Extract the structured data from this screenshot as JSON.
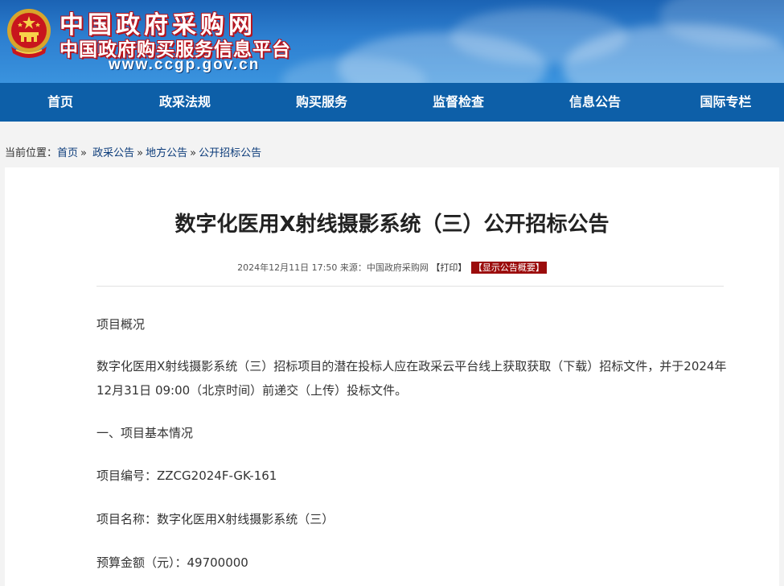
{
  "header": {
    "title_main": "中国政府采购网",
    "title_sub": "中国政府购买服务信息平台",
    "url": "www.ccgp.gov.cn"
  },
  "nav": {
    "items": [
      "首页",
      "政采法规",
      "购买服务",
      "监督检查",
      "信息公告",
      "国际专栏"
    ]
  },
  "breadcrumb": {
    "prefix": "当前位置：",
    "items": [
      "首页",
      "政采公告",
      "地方公告",
      "公开招标公告"
    ],
    "separator": "»"
  },
  "article": {
    "title": "数字化医用X射线摄影系统（三）公开招标公告",
    "meta_text": "2024年12月11日 17:50 来源：中国政府采购网",
    "print_label": "【打印】",
    "summary_label": "【显示公告概要】",
    "paragraphs": {
      "overview_heading": "项目概况",
      "intro": "数字化医用X射线摄影系统（三）招标项目的潜在投标人应在政采云平台线上获取获取（下载）招标文件，并于2024年12月31日 09:00（北京时间）前递交（上传）投标文件。",
      "section1": "一、项目基本情况",
      "project_no": "项目编号：ZZCG2024F-GK-161",
      "project_name": "项目名称：数字化医用X射线摄影系统（三）",
      "budget": "预算金额（元）：49700000"
    }
  },
  "colors": {
    "nav_bg": "#0d5fa8",
    "summary_bg": "#9b0c0c",
    "title_outline": "#b7121b"
  }
}
